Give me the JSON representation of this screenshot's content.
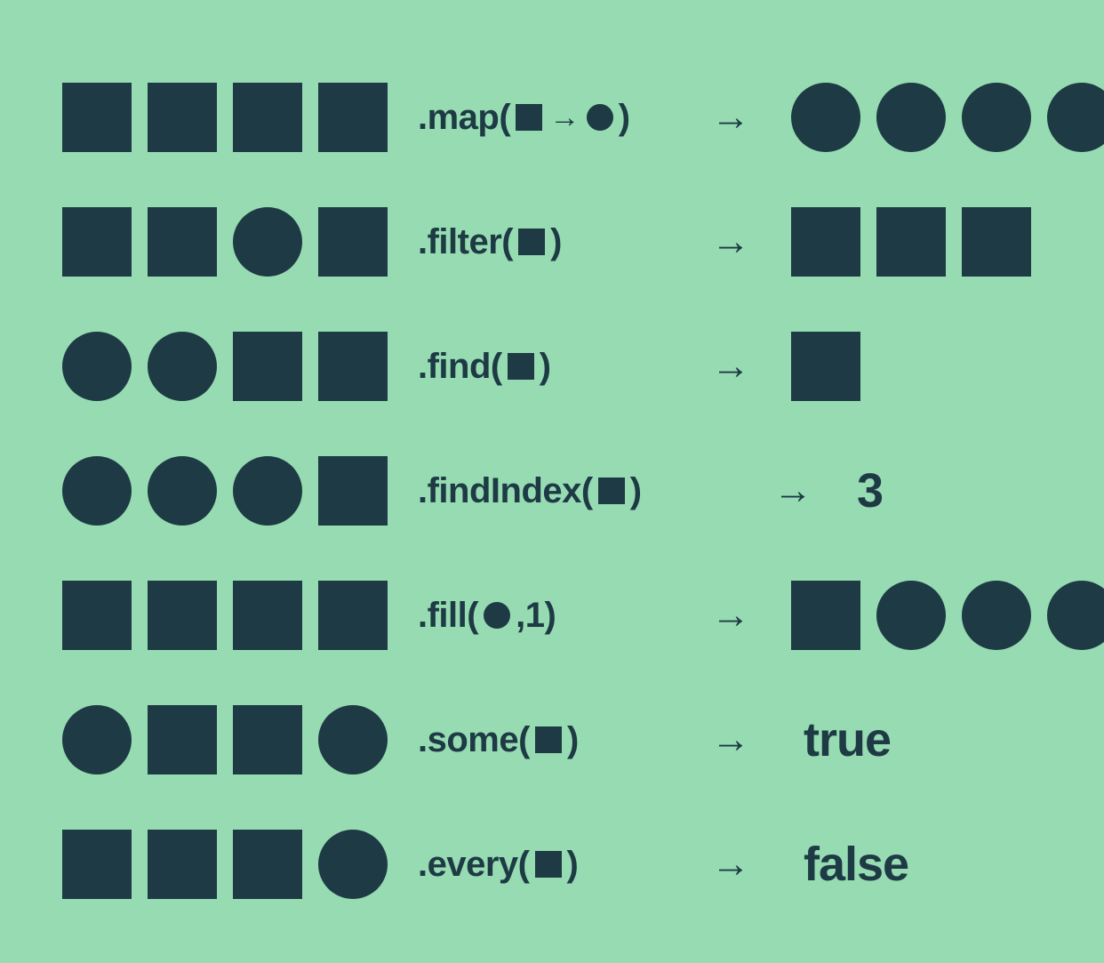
{
  "colors": {
    "bg": "#96dbb2",
    "fg": "#1e3a44"
  },
  "rows": [
    {
      "input": [
        "square",
        "square",
        "square",
        "square"
      ],
      "method": {
        "name": ".map",
        "args": [
          {
            "t": "shape",
            "v": "square"
          },
          {
            "t": "arrow"
          },
          {
            "t": "shape",
            "v": "circle"
          }
        ]
      },
      "arrow": "→",
      "output": {
        "type": "shapes",
        "value": [
          "circle",
          "circle",
          "circle",
          "circle"
        ]
      }
    },
    {
      "input": [
        "square",
        "square",
        "circle",
        "square"
      ],
      "method": {
        "name": ".filter",
        "args": [
          {
            "t": "shape",
            "v": "square"
          }
        ]
      },
      "arrow": "→",
      "output": {
        "type": "shapes",
        "value": [
          "square",
          "square",
          "square"
        ]
      }
    },
    {
      "input": [
        "circle",
        "circle",
        "square",
        "square"
      ],
      "method": {
        "name": ".find",
        "args": [
          {
            "t": "shape",
            "v": "square"
          }
        ]
      },
      "arrow": "→",
      "output": {
        "type": "shapes",
        "value": [
          "square"
        ]
      }
    },
    {
      "input": [
        "circle",
        "circle",
        "circle",
        "square"
      ],
      "method": {
        "name": ".findIndex",
        "args": [
          {
            "t": "shape",
            "v": "square"
          }
        ]
      },
      "arrow": "→",
      "output": {
        "type": "text",
        "value": "3"
      }
    },
    {
      "input": [
        "square",
        "square",
        "square",
        "square"
      ],
      "method": {
        "name": ".fill",
        "args": [
          {
            "t": "shape",
            "v": "circle"
          },
          {
            "t": "text",
            "v": ",1 "
          }
        ]
      },
      "arrow": "→",
      "output": {
        "type": "shapes",
        "value": [
          "square",
          "circle",
          "circle",
          "circle"
        ]
      }
    },
    {
      "input": [
        "circle",
        "square",
        "square",
        "circle"
      ],
      "method": {
        "name": ".some",
        "args": [
          {
            "t": "shape",
            "v": "square"
          }
        ]
      },
      "arrow": "→",
      "output": {
        "type": "text",
        "value": "true"
      }
    },
    {
      "input": [
        "square",
        "square",
        "square",
        "circle"
      ],
      "method": {
        "name": ".every",
        "args": [
          {
            "t": "shape",
            "v": "square"
          }
        ]
      },
      "arrow": "→",
      "output": {
        "type": "text",
        "value": "false"
      }
    }
  ]
}
